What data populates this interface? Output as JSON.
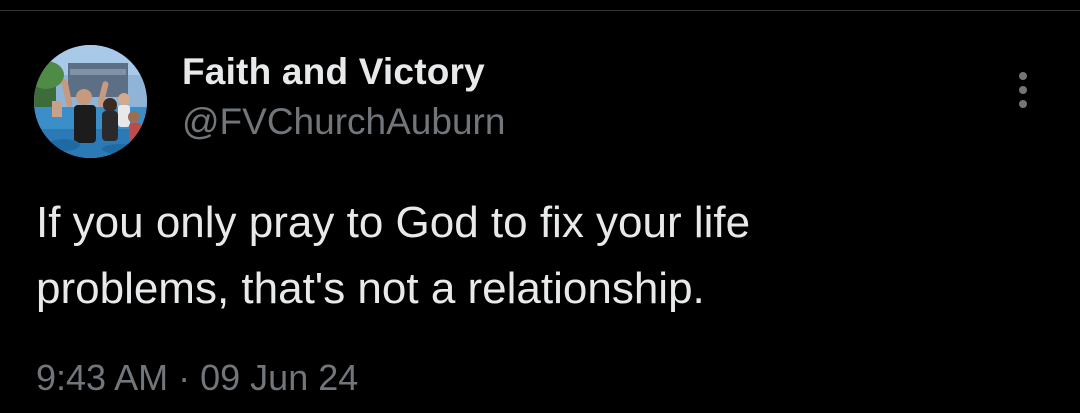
{
  "post": {
    "author": {
      "display_name": "Faith and Victory",
      "handle": "@FVChurchAuburn",
      "avatar": "profile-photo"
    },
    "text_lines": [
      "If you only pray to God to fix your life",
      "problems, that's not a relationship."
    ],
    "time": "9:43 AM",
    "separator": "·",
    "date": "09 Jun 24",
    "more_icon": "more-vertical-icon"
  },
  "colors": {
    "background": "#000000",
    "primary_text": "#e7e9ea",
    "secondary_text": "#71767b",
    "divider": "#2f3336"
  }
}
